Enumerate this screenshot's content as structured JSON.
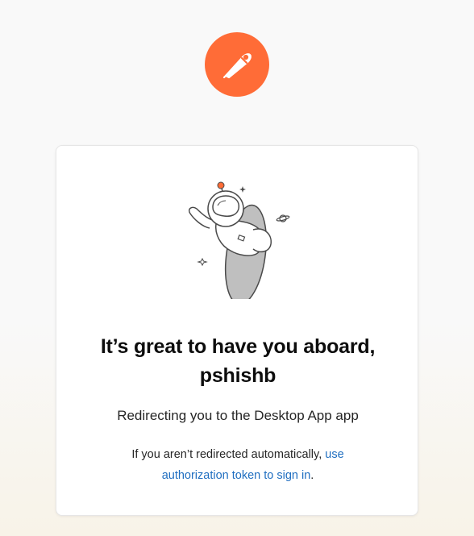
{
  "brand": {
    "logo_icon": "postman-astronaut-rocket-icon",
    "accent_color": "#ff6c37"
  },
  "card": {
    "illustration_icon": "astronaut-floating-illustration",
    "heading_line1": "It’s great to have you aboard,",
    "heading_line2": "pshishb",
    "redirect_text": "Redirecting you to the Desktop App app",
    "fallback_text": "If you aren’t redirected automatically, ",
    "fallback_link": "use authorization token to sign in",
    "fallback_end": ".",
    "link_color": "#1f6ec0"
  }
}
